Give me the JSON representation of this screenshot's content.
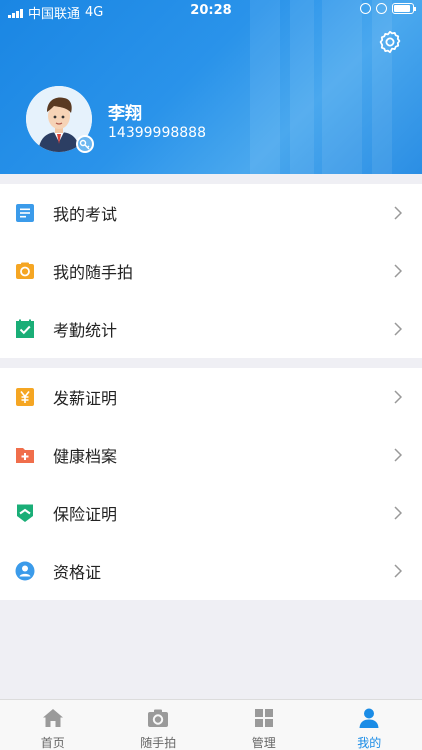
{
  "status_bar": {
    "carrier": "中国联通",
    "network": "4G",
    "time": "20:28"
  },
  "profile": {
    "name": "李翔",
    "phone": "14399998888"
  },
  "menu_group_1": [
    {
      "label": "我的考试",
      "icon": "document-icon",
      "color": "#3b9bea"
    },
    {
      "label": "我的随手拍",
      "icon": "camera-icon",
      "color": "#f5a623"
    },
    {
      "label": "考勤统计",
      "icon": "checkmark-icon",
      "color": "#1aae77"
    }
  ],
  "menu_group_2": [
    {
      "label": "发薪证明",
      "icon": "yen-icon",
      "color": "#f5a623"
    },
    {
      "label": "健康档案",
      "icon": "medical-folder-icon",
      "color": "#f06e4b"
    },
    {
      "label": "保险证明",
      "icon": "shield-icon",
      "color": "#1aae77"
    },
    {
      "label": "资格证",
      "icon": "certificate-icon",
      "color": "#3b9bea"
    }
  ],
  "tabbar": [
    {
      "label": "首页",
      "icon": "home-icon"
    },
    {
      "label": "随手拍",
      "icon": "camera-icon"
    },
    {
      "label": "管理",
      "icon": "grid-icon"
    },
    {
      "label": "我的",
      "icon": "person-icon",
      "active": true
    }
  ],
  "colors": {
    "accent": "#1a8ce6",
    "header_blue": "#2a93ea",
    "tab_inactive": "#666666"
  }
}
